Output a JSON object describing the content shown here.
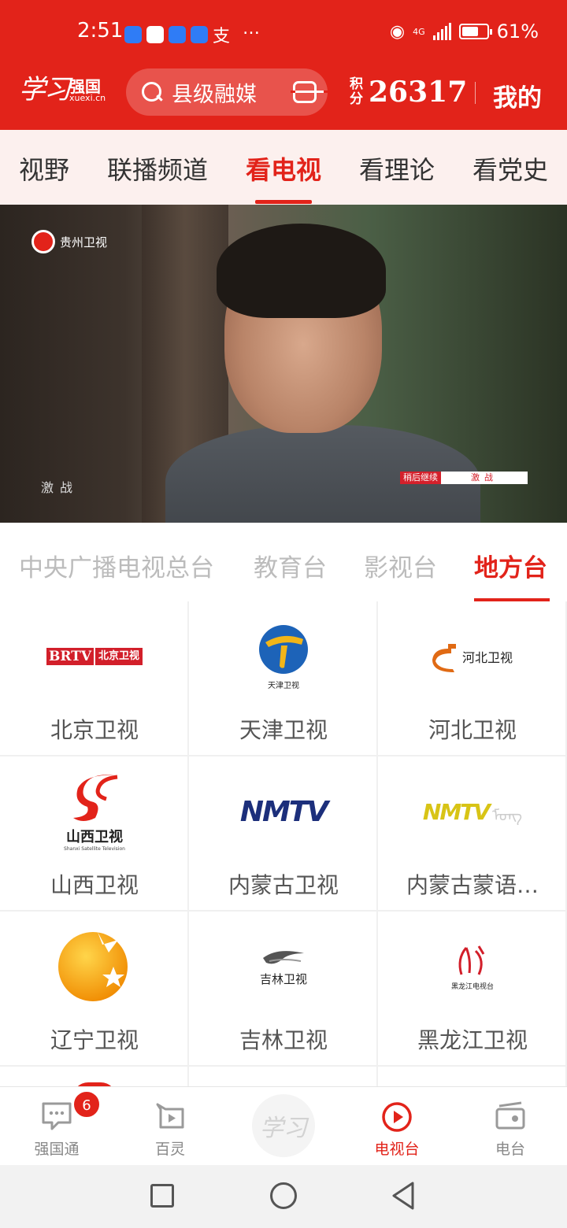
{
  "status_bar": {
    "time": "2:51",
    "more": "…",
    "network": "4G",
    "battery": "61%"
  },
  "header": {
    "logo_name": "强国",
    "logo_url": "xuexi.cn",
    "search_placeholder": "县级融媒",
    "points_label": "积分",
    "points_value": "26317",
    "mine_label": "我的",
    "accent_color": "#e2231a"
  },
  "top_tabs": {
    "items": [
      {
        "label": "视野"
      },
      {
        "label": "联播频道"
      },
      {
        "label": "看电视"
      },
      {
        "label": "看理论"
      },
      {
        "label": "看党史"
      }
    ],
    "active_index": 2
  },
  "video": {
    "channel_watermark": "贵州卫视",
    "subtitle": "激战",
    "banner_left": "稍后继续",
    "banner_right": "激战"
  },
  "category_tabs": {
    "items": [
      {
        "label": "中央广播电视总台"
      },
      {
        "label": "教育台"
      },
      {
        "label": "影视台"
      },
      {
        "label": "地方台"
      }
    ],
    "active_index": 3
  },
  "channels": [
    {
      "name": "北京卫视",
      "logo_icon": "brtv-logo",
      "logo_text_a": "BRTV",
      "logo_text_b": "北京卫视"
    },
    {
      "name": "天津卫视",
      "logo_icon": "tianjin-tv-logo",
      "logo_text_a": "天津卫视"
    },
    {
      "name": "河北卫视",
      "logo_icon": "hebei-tv-logo",
      "logo_text_a": "河北卫视"
    },
    {
      "name": "山西卫视",
      "logo_icon": "shanxi-tv-logo",
      "logo_text_a": "山西卫视",
      "logo_text_b": "Shanxi Satellite Television"
    },
    {
      "name": "内蒙古卫视",
      "logo_icon": "nmtv-logo",
      "logo_text_a": "NMTV"
    },
    {
      "name": "内蒙古蒙语…",
      "logo_icon": "nmtv-mongolian-logo",
      "logo_text_a": "NMTV"
    },
    {
      "name": "辽宁卫视",
      "logo_icon": "liaoning-tv-logo"
    },
    {
      "name": "吉林卫视",
      "logo_icon": "jilin-tv-logo",
      "logo_text_a": "吉林卫视"
    },
    {
      "name": "黑龙江卫视",
      "logo_icon": "heilongjiang-tv-logo",
      "logo_text_a": "黑龙江电视台"
    }
  ],
  "bottom_nav": {
    "items": [
      {
        "label": "强国通",
        "icon": "chat-icon",
        "badge": "6"
      },
      {
        "label": "百灵",
        "icon": "play-square-icon"
      },
      {
        "label": "",
        "icon": "xuexi-center-icon",
        "center_text": "学习"
      },
      {
        "label": "电视台",
        "icon": "tv-play-icon"
      },
      {
        "label": "电台",
        "icon": "radio-icon"
      }
    ],
    "active_index": 3
  }
}
